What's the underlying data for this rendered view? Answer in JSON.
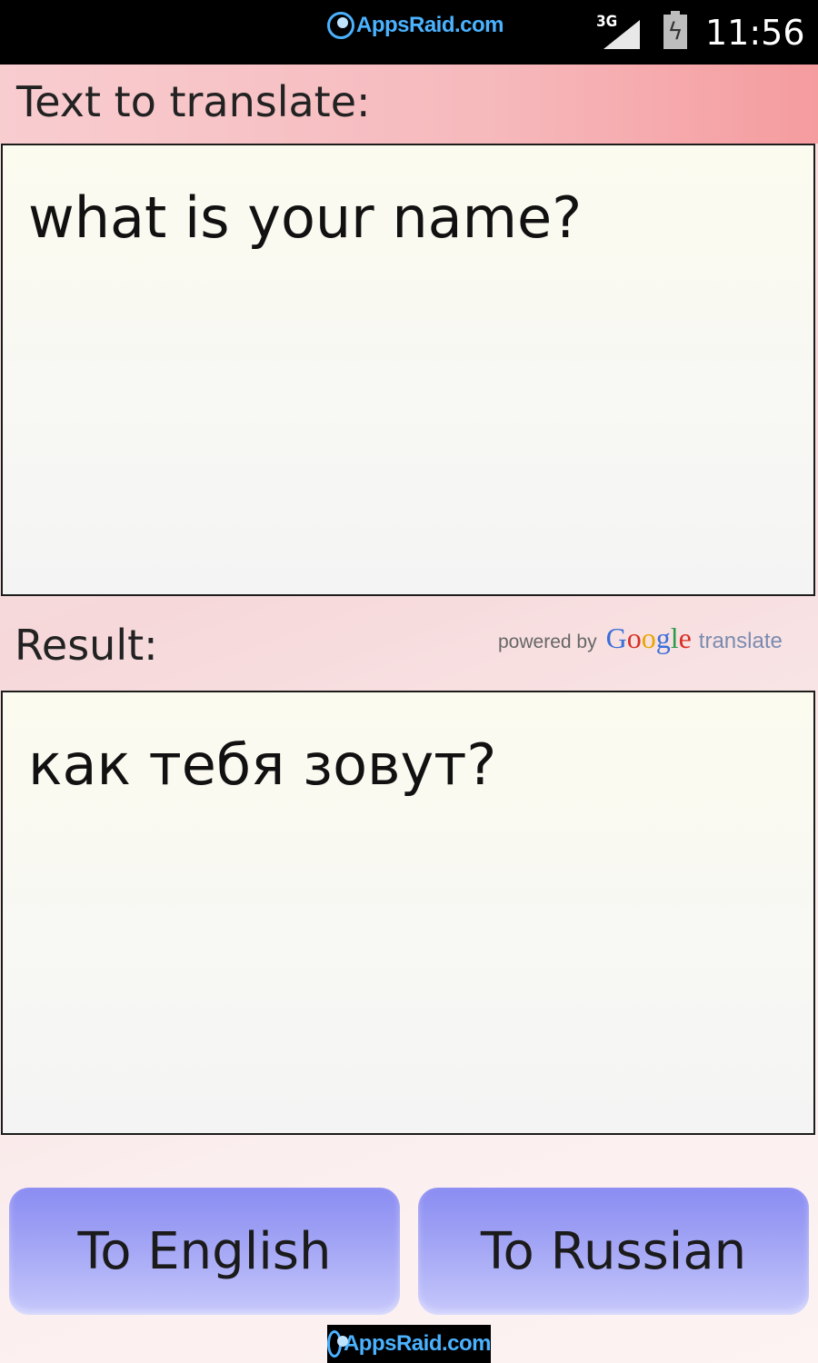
{
  "status_bar": {
    "watermark": "AppsRaid.com",
    "network": "3G",
    "time": "11:56"
  },
  "source": {
    "label": "Text to translate:",
    "value": "what is your name?"
  },
  "result": {
    "label": "Result:",
    "value": "как тебя зовут?",
    "powered_by": {
      "prefix": "powered by",
      "brand": "Google",
      "suffix": "translate"
    }
  },
  "buttons": {
    "to_english": "To English",
    "to_russian": "To Russian"
  },
  "footer": {
    "watermark": "AppsRaid.com"
  },
  "colors": {
    "header_band": "#f6b9bc",
    "button": "#a3a5f5",
    "watermark": "#4ab2ff"
  }
}
